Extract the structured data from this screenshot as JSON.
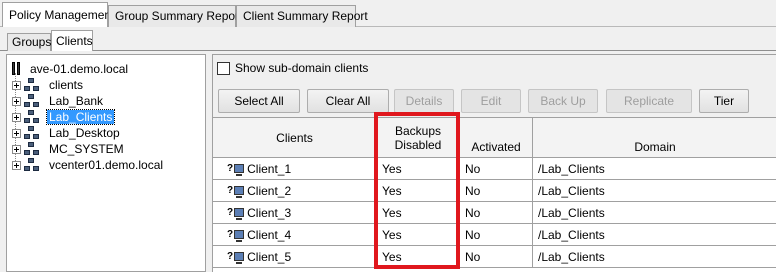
{
  "top_tabs": [
    {
      "label": "Policy Management",
      "active": true
    },
    {
      "label": "Group Summary Reports",
      "active": false
    },
    {
      "label": "Client Summary Report",
      "active": false
    }
  ],
  "sub_tabs": [
    {
      "label": "Groups",
      "active": false
    },
    {
      "label": "Clients",
      "active": true
    }
  ],
  "tree": {
    "root": "ave-01.demo.local",
    "items": [
      {
        "label": "clients",
        "selected": false
      },
      {
        "label": "Lab_Bank",
        "selected": false
      },
      {
        "label": "Lab_Clients",
        "selected": true
      },
      {
        "label": "Lab_Desktop",
        "selected": false
      },
      {
        "label": "MC_SYSTEM",
        "selected": false
      },
      {
        "label": "vcenter01.demo.local",
        "selected": false
      }
    ]
  },
  "options": {
    "show_subdomain_label": "Show sub-domain clients",
    "show_subdomain_checked": false
  },
  "toolbar": {
    "buttons": [
      {
        "label": "Select All",
        "enabled": true
      },
      {
        "label": "Clear All",
        "enabled": true
      },
      {
        "label": "Details",
        "enabled": false
      },
      {
        "label": "Edit",
        "enabled": false
      },
      {
        "label": "Back Up",
        "enabled": false
      },
      {
        "label": "Replicate",
        "enabled": false
      },
      {
        "label": "Tier",
        "enabled": true
      }
    ]
  },
  "table": {
    "headers": {
      "clients": "Clients",
      "backups_disabled_1": "Backups",
      "backups_disabled_2": "Disabled",
      "activated": "Activated",
      "domain": "Domain"
    },
    "rows": [
      {
        "client": "Client_1",
        "backups_disabled": "Yes",
        "activated": "No",
        "domain": "/Lab_Clients"
      },
      {
        "client": "Client_2",
        "backups_disabled": "Yes",
        "activated": "No",
        "domain": "/Lab_Clients"
      },
      {
        "client": "Client_3",
        "backups_disabled": "Yes",
        "activated": "No",
        "domain": "/Lab_Clients"
      },
      {
        "client": "Client_4",
        "backups_disabled": "Yes",
        "activated": "No",
        "domain": "/Lab_Clients"
      },
      {
        "client": "Client_5",
        "backups_disabled": "Yes",
        "activated": "No",
        "domain": "/Lab_Clients"
      }
    ],
    "client_icon_prefix": "?"
  },
  "colors": {
    "highlight": "#e0171d",
    "selection": "#3399ff"
  }
}
